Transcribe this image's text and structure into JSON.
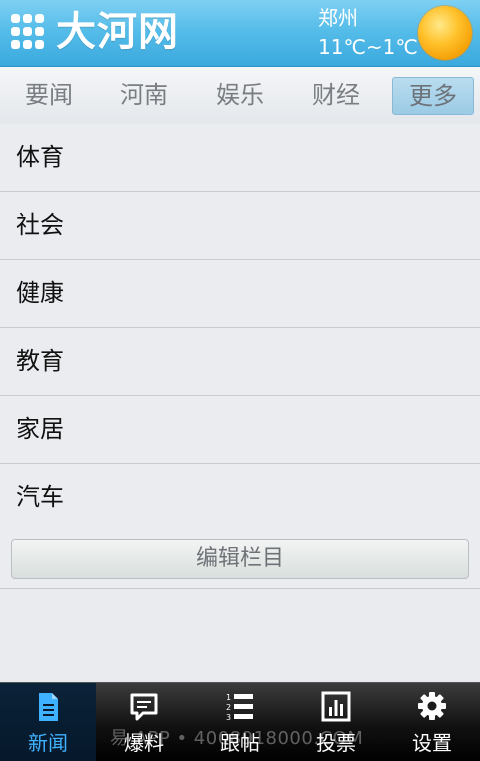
{
  "header": {
    "logo_text": "大河网",
    "city": "郑州",
    "temperature": "11℃~1℃",
    "weather_icon": "sun-icon",
    "accent": "#4cb7e6"
  },
  "tabs": [
    {
      "label": "要闻"
    },
    {
      "label": "河南"
    },
    {
      "label": "娱乐"
    },
    {
      "label": "财经"
    },
    {
      "label": "更多",
      "active": true
    }
  ],
  "categories": [
    {
      "label": "体育"
    },
    {
      "label": "社会"
    },
    {
      "label": "健康"
    },
    {
      "label": "教育"
    },
    {
      "label": "家居"
    },
    {
      "label": "汽车"
    }
  ],
  "edit_button": {
    "label": "编辑栏目"
  },
  "bottom_nav": [
    {
      "label": "新闻",
      "icon": "document-icon",
      "active": true
    },
    {
      "label": "爆料",
      "icon": "speech-bubble-icon"
    },
    {
      "label": "跟帖",
      "icon": "numbered-list-icon"
    },
    {
      "label": "投票",
      "icon": "bar-chart-icon"
    },
    {
      "label": "设置",
      "icon": "gear-icon"
    }
  ],
  "watermark": "易 APP • 4008918000.COM"
}
